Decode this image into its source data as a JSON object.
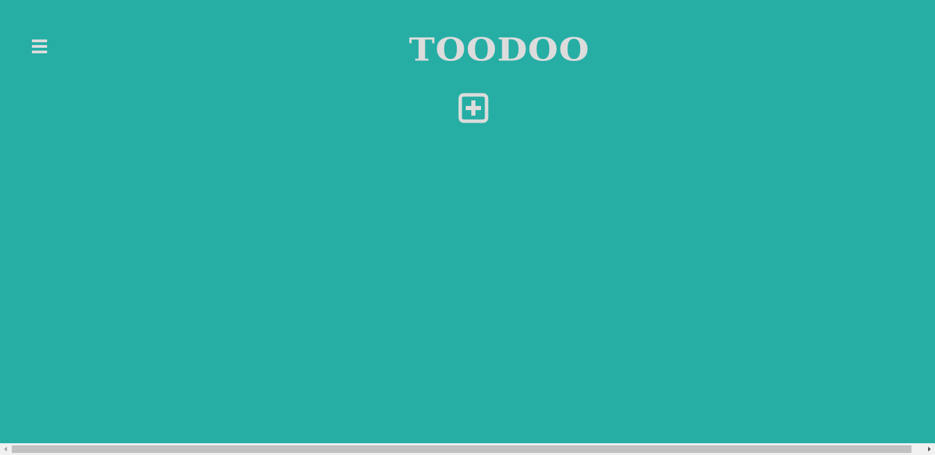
{
  "app": {
    "title": "TOODOO",
    "background_color": "#26aea5",
    "foreground_color": "#dcdcdc"
  },
  "header": {
    "menu_icon": "hamburger-menu-icon",
    "add_icon": "plus-square-icon"
  },
  "scrollbar": {
    "orientation": "horizontal",
    "left_arrow_icon": "scroll-left-arrow-icon",
    "right_arrow_icon": "scroll-right-arrow-icon"
  }
}
